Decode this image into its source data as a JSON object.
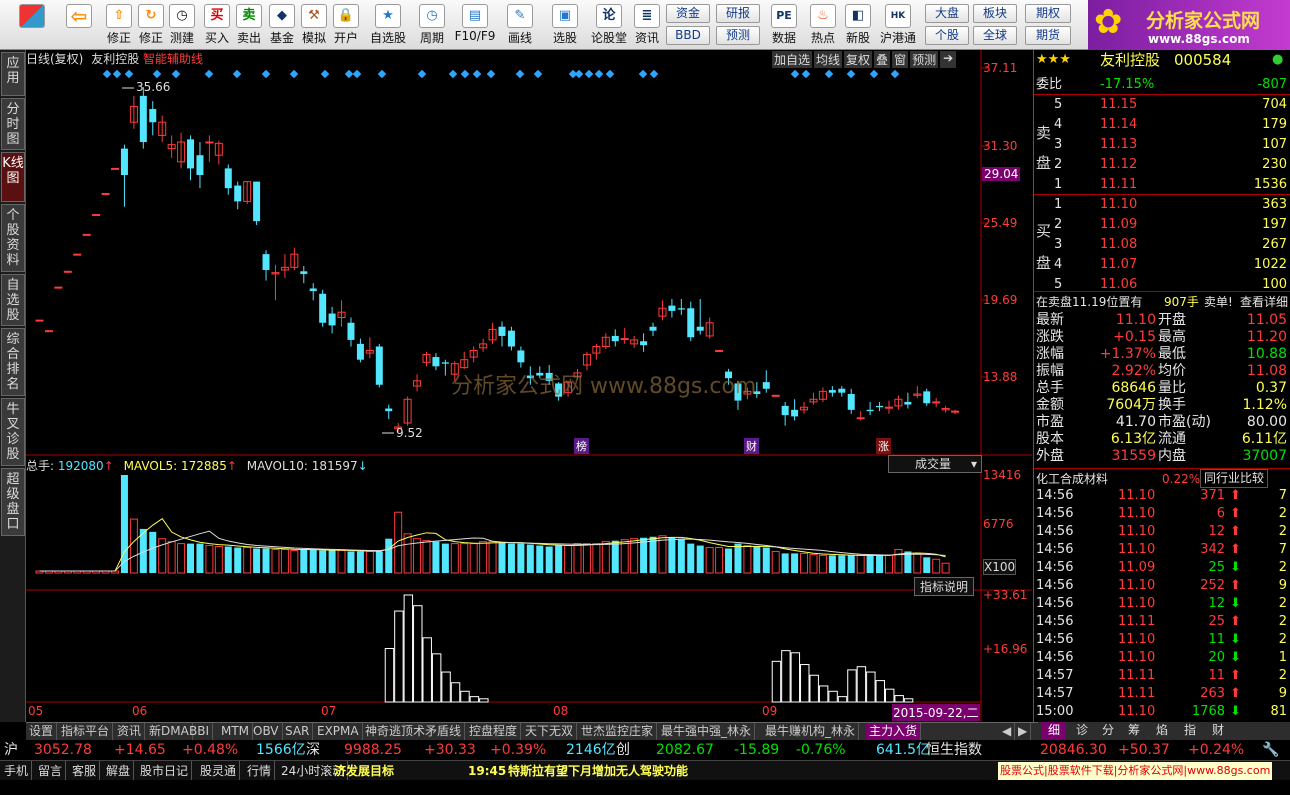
{
  "toolbar": {
    "buttons": [
      {
        "label": "修正",
        "icon": "arrow-up-icon"
      },
      {
        "label": "测建",
        "icon": "clock-icon"
      },
      {
        "label": "买入",
        "icon": "buy-icon",
        "char": "买"
      },
      {
        "label": "卖出",
        "icon": "sell-icon",
        "char": "卖"
      },
      {
        "label": "基金",
        "icon": "fund-icon"
      },
      {
        "label": "模拟",
        "icon": "hammer-icon"
      },
      {
        "label": "开户",
        "icon": "lock-icon"
      },
      {
        "label": "自选股",
        "icon": "star-icon"
      },
      {
        "label": "周期",
        "icon": "clock-icon"
      },
      {
        "label": "F10/F9",
        "icon": "table-icon"
      },
      {
        "label": "画线",
        "icon": "pen-icon"
      },
      {
        "label": "选股",
        "icon": "screen-icon"
      },
      {
        "label": "论股堂",
        "icon": "talk-icon",
        "char": "论"
      },
      {
        "label": "资讯",
        "icon": "news-icon"
      },
      {
        "label": "数据",
        "icon": "data-icon",
        "char": "PE"
      },
      {
        "label": "热点",
        "icon": "fire-icon"
      },
      {
        "label": "新股",
        "icon": "newstock-icon"
      },
      {
        "label": "沪港通",
        "icon": "hk-icon"
      }
    ],
    "small": {
      "zijin": "资金",
      "yanbao": "研报",
      "bbd": "BBD",
      "yuce": "预测",
      "dapan": "大盘",
      "bankuai": "板块",
      "geg": "个股",
      "quanqiu": "全球",
      "qihuo": "期权",
      "qihuo2": "期货"
    }
  },
  "brand": {
    "name": "分析家公式网",
    "url": "www.88gs.com"
  },
  "leftnav": [
    "应用",
    "分时图",
    "K线图",
    "个股资料",
    "自选股",
    "综合排名",
    "牛叉诊股",
    "超级盘口"
  ],
  "chart": {
    "title": "日线(复权)",
    "stock": "友利控股",
    "aux": "智能辅助线",
    "tabs": [
      "加自选",
      "均线",
      "复权",
      "叠",
      "窗",
      "预测"
    ],
    "price_axis": [
      "37.11",
      "31.30",
      "25.49",
      "19.69",
      "13.88"
    ],
    "current_price_tag": "29.04",
    "high_label": "35.66",
    "low_label": "9.52",
    "watermark": "分析家公式网   www.88gs.com",
    "markers": [
      "榜",
      "财",
      "涨"
    ],
    "volume": {
      "label": "总手:",
      "value": "192080",
      "ma5_label": "MAVOL5:",
      "ma5": "172885",
      "ma10_label": "MAVOL10:",
      "ma10": "181597",
      "dropdown": "成交量",
      "axis": [
        "13416",
        "6776"
      ],
      "unit": "X100"
    },
    "indicator": {
      "button": "指标说明",
      "axis": [
        "+33.61",
        "+16.96"
      ]
    },
    "x_labels": [
      "05",
      "06",
      "07",
      "08",
      "09"
    ],
    "date_tag": "2015-09-22,二"
  },
  "chart_data": {
    "type": "candlestick",
    "ylim": [
      9.52,
      37.11
    ],
    "high": 35.66,
    "low": 9.52
  },
  "quote": {
    "stars": "★★★",
    "name": "友利控股",
    "code": "000584",
    "weibi_label": "委比",
    "weibi": "-17.15%",
    "weicha": "-807",
    "sell_label": [
      "卖",
      "盘"
    ],
    "buy_label": [
      "买",
      "盘"
    ],
    "sell": [
      {
        "lv": "5",
        "p": "11.15",
        "v": "704"
      },
      {
        "lv": "4",
        "p": "11.14",
        "v": "179"
      },
      {
        "lv": "3",
        "p": "11.13",
        "v": "107"
      },
      {
        "lv": "2",
        "p": "11.12",
        "v": "230"
      },
      {
        "lv": "1",
        "p": "11.11",
        "v": "1536"
      }
    ],
    "buy": [
      {
        "lv": "1",
        "p": "11.10",
        "v": "363"
      },
      {
        "lv": "2",
        "p": "11.09",
        "v": "197"
      },
      {
        "lv": "3",
        "p": "11.08",
        "v": "267"
      },
      {
        "lv": "4",
        "p": "11.07",
        "v": "1022"
      },
      {
        "lv": "5",
        "p": "11.06",
        "v": "100"
      }
    ],
    "order_note": "在卖盘11.19位置有",
    "order_vol": "907手",
    "order_act": "卖单!",
    "order_link": "查看详细",
    "stats": [
      {
        "l": "最新",
        "v": "11.10",
        "vc": "red",
        "l2": "开盘",
        "v2": "11.05",
        "v2c": "red"
      },
      {
        "l": "涨跌",
        "v": "+0.15",
        "vc": "red",
        "l2": "最高",
        "v2": "11.20",
        "v2c": "red"
      },
      {
        "l": "涨幅",
        "v": "+1.37%",
        "vc": "red",
        "l2": "最低",
        "v2": "10.88",
        "v2c": "grn"
      },
      {
        "l": "振幅",
        "v": "2.92%",
        "vc": "red",
        "l2": "均价",
        "v2": "11.08",
        "v2c": "red"
      },
      {
        "l": "总手",
        "v": "68646",
        "vc": "yel",
        "l2": "量比",
        "v2": "0.37",
        "v2c": "yel"
      },
      {
        "l": "金额",
        "v": "7604万",
        "vc": "yel",
        "l2": "换手",
        "v2": "1.12%",
        "v2c": "yel"
      },
      {
        "l": "市盈",
        "v": "41.70",
        "vc": "wh",
        "l2": "市盈(动)",
        "v2": "80.00",
        "v2c": "wh"
      },
      {
        "l": "股本",
        "v": "6.13亿",
        "vc": "yel",
        "l2": "流通",
        "v2": "6.11亿",
        "v2c": "yel"
      },
      {
        "l": "外盘",
        "v": "31559",
        "vc": "red",
        "l2": "内盘",
        "v2": "37007",
        "v2c": "grn"
      }
    ],
    "industry": "化工合成材料",
    "industry_pct": "0.22%",
    "compare": "同行业比较",
    "ticks": [
      {
        "t": "14:56",
        "p": "11.10",
        "pc": "red",
        "v": "371",
        "vc": "red",
        "d": "up",
        "n": "7"
      },
      {
        "t": "14:56",
        "p": "11.10",
        "pc": "red",
        "v": "6",
        "vc": "red",
        "d": "up",
        "n": "2"
      },
      {
        "t": "14:56",
        "p": "11.10",
        "pc": "red",
        "v": "12",
        "vc": "red",
        "d": "up",
        "n": "2"
      },
      {
        "t": "14:56",
        "p": "11.10",
        "pc": "red",
        "v": "342",
        "vc": "red",
        "d": "up",
        "n": "7"
      },
      {
        "t": "14:56",
        "p": "11.09",
        "pc": "red",
        "v": "25",
        "vc": "grn",
        "d": "down",
        "n": "2"
      },
      {
        "t": "14:56",
        "p": "11.10",
        "pc": "red",
        "v": "252",
        "vc": "red",
        "d": "up",
        "n": "9"
      },
      {
        "t": "14:56",
        "p": "11.10",
        "pc": "red",
        "v": "12",
        "vc": "grn",
        "d": "down",
        "n": "2"
      },
      {
        "t": "14:56",
        "p": "11.11",
        "pc": "red",
        "v": "25",
        "vc": "red",
        "d": "up",
        "n": "2"
      },
      {
        "t": "14:56",
        "p": "11.10",
        "pc": "red",
        "v": "11",
        "vc": "grn",
        "d": "down",
        "n": "2"
      },
      {
        "t": "14:56",
        "p": "11.10",
        "pc": "red",
        "v": "20",
        "vc": "grn",
        "d": "down",
        "n": "1"
      },
      {
        "t": "14:57",
        "p": "11.11",
        "pc": "red",
        "v": "11",
        "vc": "red",
        "d": "up",
        "n": "2"
      },
      {
        "t": "14:57",
        "p": "11.11",
        "pc": "red",
        "v": "263",
        "vc": "red",
        "d": "up",
        "n": "9"
      },
      {
        "t": "15:00",
        "p": "11.10",
        "pc": "red",
        "v": "1768",
        "vc": "grn",
        "d": "down",
        "n": "81"
      }
    ],
    "rtabs": [
      "细",
      "诊",
      "分",
      "筹",
      "焰",
      "指",
      "财"
    ]
  },
  "bottom_tabs": [
    "设置",
    "指标平台",
    "资讯",
    "新DMA",
    "BBI",
    "MTM",
    "OBV",
    "SAR",
    "EXPMA",
    "神奇逃顶术矛盾线",
    "控盘程度",
    "天下无双",
    "世杰监控庄家",
    "最牛强中强_林永",
    "最牛赚机构_林永",
    "主力入货"
  ],
  "index_bar": {
    "sh_label": "沪",
    "sh": "3052.78",
    "sh_ch": "+14.65",
    "sh_pct": "+0.48%",
    "sh_amt": "1566亿",
    "sz_label": "深",
    "sz": "9988.25",
    "sz_ch": "+30.33",
    "sz_pct": "+0.39%",
    "sz_amt": "2146亿",
    "cy_label": "创",
    "cy": "2082.67",
    "cy_ch": "-15.89",
    "cy_pct": "-0.76%",
    "cy_amt": "641.5亿",
    "hs_label": "恒生指数",
    "hs": "20846.30",
    "hs_ch": "+50.37",
    "hs_pct": "+0.24%"
  },
  "status": {
    "items": [
      "手机",
      "留言",
      "客服",
      "解盘",
      "股市日记",
      "股灵通",
      "行情",
      "24小时滚动"
    ],
    "ticker1": "济发展目标",
    "time": "19:45",
    "news": "特斯拉有望下月增加无人驾驶功能",
    "ad": "股票公式|股票软件下载|分析家公式网|www.88gs.com"
  }
}
